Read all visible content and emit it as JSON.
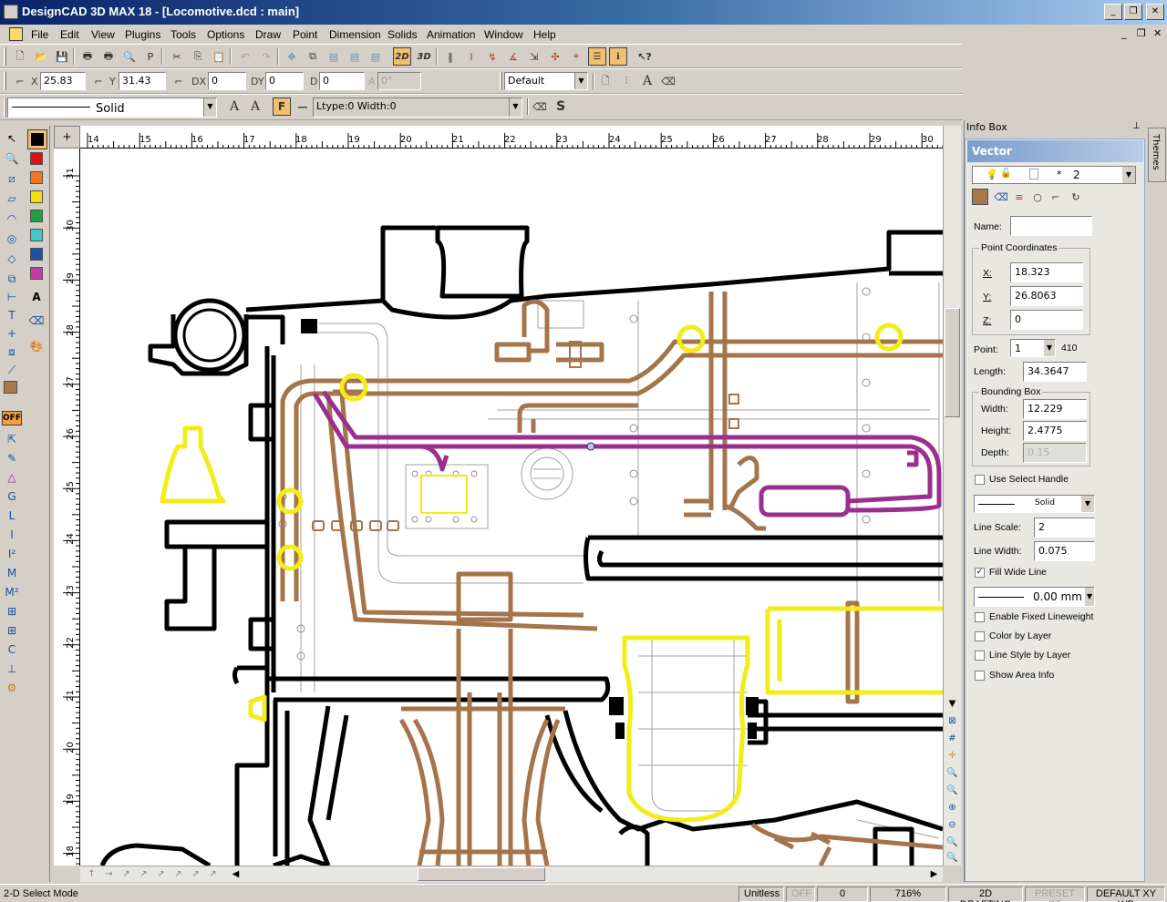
{
  "window": {
    "title": "DesignCAD 3D MAX 18 - [Locomotive.dcd : main]",
    "controls": [
      "_",
      "❐",
      "✕"
    ]
  },
  "menu": {
    "items": [
      "File",
      "Edit",
      "View",
      "Plugins",
      "Tools",
      "Options",
      "Draw",
      "Point",
      "Dimension",
      "Solids",
      "Animation",
      "Window",
      "Help"
    ],
    "mdi_controls": [
      "_",
      "❐",
      "✕"
    ]
  },
  "toolbar": {
    "btn_2d": "2D",
    "btn_3d": "3D"
  },
  "coords": {
    "x_label": "X",
    "x_value": "25.83",
    "y_label": "Y",
    "y_value": "31.43",
    "dx_label": "DX",
    "dx_value": "0",
    "dy_label": "DY",
    "dy_value": "0",
    "d_label": "D",
    "d_value": "0",
    "a_label": "A",
    "a_value": "0°",
    "layer_value": "Default"
  },
  "linestyle_bar": {
    "style_value": "Solid",
    "f_button": "F",
    "ltype_text": "Ltype:0  Width:0",
    "s_button": "S"
  },
  "left_toolbox": {
    "off_badge": "OFF",
    "text_tool": "A"
  },
  "colors": {
    "black": "#000000",
    "red": "#e01010",
    "orange": "#f07820",
    "yellow": "#f0e010",
    "green": "#20a040",
    "cyan": "#40c8c8",
    "blue": "#2050a0",
    "magenta": "#c040a0",
    "brown": "#a87848",
    "wire_brown": "#a5744a",
    "wire_magenta": "#9a2f8f",
    "wire_yellow": "#f2ec1a",
    "selection_blue": "#0a246a"
  },
  "ruler": {
    "top_ticks": [
      "14",
      "15",
      "16",
      "17",
      "18",
      "19",
      "20",
      "21",
      "22",
      "23",
      "24",
      "25",
      "26",
      "27",
      "28",
      "29",
      "30"
    ],
    "left_ticks": [
      "31",
      "30",
      "29",
      "28",
      "27",
      "26",
      "25",
      "24",
      "23",
      "22",
      "21",
      "20",
      "19",
      "18"
    ],
    "corner": "+"
  },
  "infobox": {
    "title": "Info Box",
    "pin": "⊥",
    "header": "Vector",
    "layer_combo": "2",
    "name_label": "Name:",
    "name_value": "",
    "point_coords_label": "Point Coordinates",
    "x_label": "X:",
    "x_value": "18.323",
    "y_label": "Y:",
    "y_value": "26.8063",
    "z_label": "Z:",
    "z_value": "0",
    "point_label": "Point:",
    "point_value": "1",
    "point_total": "410",
    "length_label": "Length:",
    "length_value": "34.3647",
    "bbox_label": "Bounding Box",
    "width_label": "Width:",
    "width_value": "12.229",
    "height_label": "Height:",
    "height_value": "2.4775",
    "depth_label": "Depth:",
    "depth_value": "0.15",
    "use_select_handle": "Use Select Handle",
    "line_style_value": "Solid",
    "line_scale_label": "Line Scale:",
    "line_scale_value": "2",
    "line_width_label": "Line Width:",
    "line_width_value": "0.075",
    "fill_wide_line": "Fill Wide Line",
    "lineweight_value": "0.00 mm",
    "enable_fixed_lineweight": "Enable Fixed Lineweight",
    "color_by_layer": "Color by Layer",
    "line_style_by_layer": "Line Style by Layer",
    "show_area_info": "Show Area Info",
    "fill_wide_line_checked": true
  },
  "side_tab": {
    "themes": "Themes"
  },
  "status": {
    "mode": "2-D Select Mode",
    "units": "Unitless",
    "off": "OFF",
    "value": "0",
    "zoom": "716%",
    "drafting": "2D DRAFTING",
    "preset": "PRESET PT",
    "workplane": "DEFAULT XY WP"
  }
}
